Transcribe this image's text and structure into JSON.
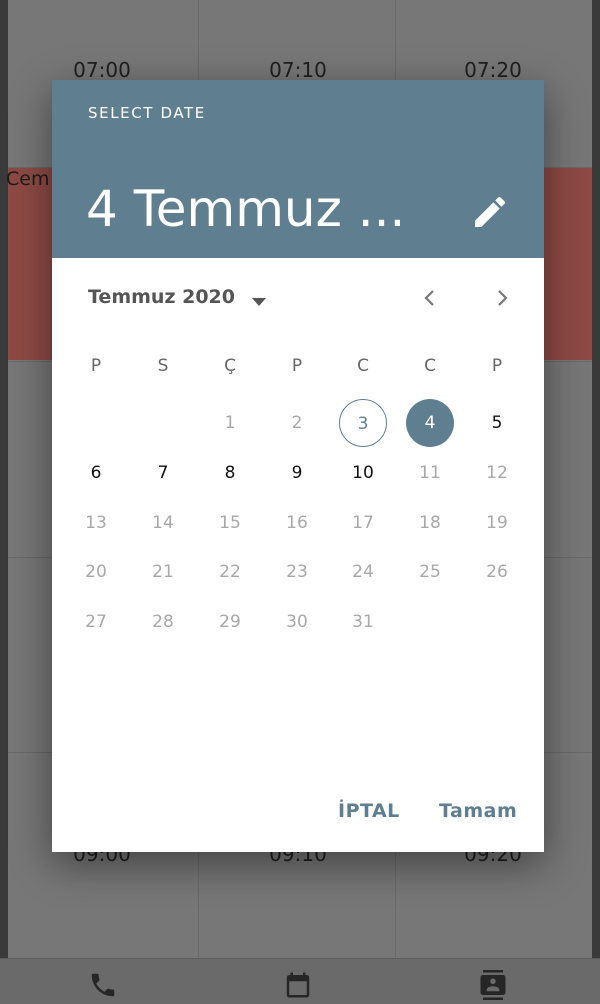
{
  "background": {
    "times_top": [
      "07:00",
      "07:10",
      "07:20"
    ],
    "times_bottom": [
      "09:00",
      "09:10",
      "09:20"
    ],
    "event_label": "Cem",
    "nav_icons": [
      "phone-icon",
      "calendar-icon",
      "contacts-icon"
    ]
  },
  "dialog": {
    "header_label": "SELECT DATE",
    "selected_date_text": "4 Temmuz ...",
    "month_label": "Temmuz 2020",
    "weekdays": [
      "P",
      "S",
      "Ç",
      "P",
      "C",
      "C",
      "P"
    ],
    "days": [
      {
        "n": "1",
        "state": "disabled"
      },
      {
        "n": "2",
        "state": "disabled"
      },
      {
        "n": "3",
        "state": "today"
      },
      {
        "n": "4",
        "state": "selected"
      },
      {
        "n": "5",
        "state": "enabled"
      },
      {
        "n": "6",
        "state": "enabled"
      },
      {
        "n": "7",
        "state": "enabled"
      },
      {
        "n": "8",
        "state": "enabled"
      },
      {
        "n": "9",
        "state": "enabled"
      },
      {
        "n": "10",
        "state": "enabled"
      },
      {
        "n": "11",
        "state": "disabled"
      },
      {
        "n": "12",
        "state": "disabled"
      },
      {
        "n": "13",
        "state": "disabled"
      },
      {
        "n": "14",
        "state": "disabled"
      },
      {
        "n": "15",
        "state": "disabled"
      },
      {
        "n": "16",
        "state": "disabled"
      },
      {
        "n": "17",
        "state": "disabled"
      },
      {
        "n": "18",
        "state": "disabled"
      },
      {
        "n": "19",
        "state": "disabled"
      },
      {
        "n": "20",
        "state": "disabled"
      },
      {
        "n": "21",
        "state": "disabled"
      },
      {
        "n": "22",
        "state": "disabled"
      },
      {
        "n": "23",
        "state": "disabled"
      },
      {
        "n": "24",
        "state": "disabled"
      },
      {
        "n": "25",
        "state": "disabled"
      },
      {
        "n": "26",
        "state": "disabled"
      },
      {
        "n": "27",
        "state": "disabled"
      },
      {
        "n": "28",
        "state": "disabled"
      },
      {
        "n": "29",
        "state": "disabled"
      },
      {
        "n": "30",
        "state": "disabled"
      },
      {
        "n": "31",
        "state": "disabled"
      }
    ],
    "first_weekday_index": 2,
    "cancel_label": "İPTAL",
    "ok_label": "Tamam",
    "accent_color": "#5f7f91"
  }
}
